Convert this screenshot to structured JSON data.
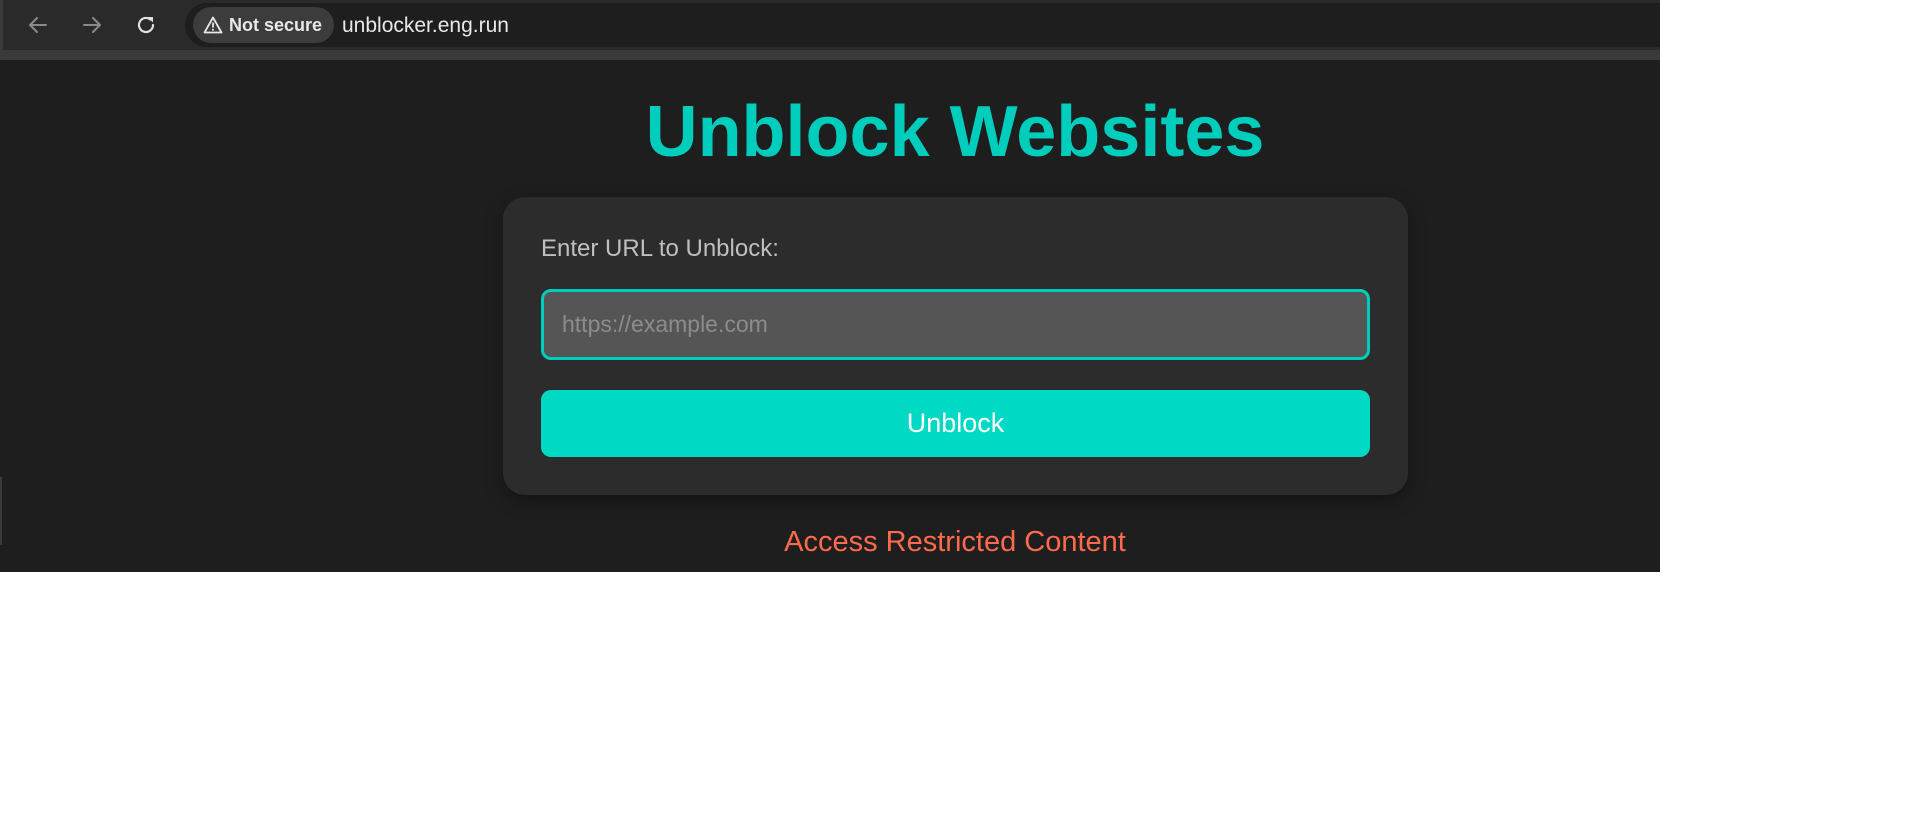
{
  "browser": {
    "security_label": "Not secure",
    "url": "unblocker.eng.run",
    "icons": {
      "back": "arrow-left-icon",
      "forward": "arrow-right-icon",
      "reload": "reload-icon",
      "security": "warning-triangle-icon"
    }
  },
  "page": {
    "title": "Unblock Websites",
    "input_label": "Enter URL to Unblock:",
    "input_placeholder": "https://example.com",
    "input_value": "",
    "button_label": "Unblock",
    "footer_text": "Access Restricted Content"
  },
  "colors": {
    "accent": "#00cdbb",
    "button": "#00d9c4",
    "warning_text": "#ff6a4c",
    "background": "#1e1e1e",
    "card": "#2c2c2c"
  }
}
